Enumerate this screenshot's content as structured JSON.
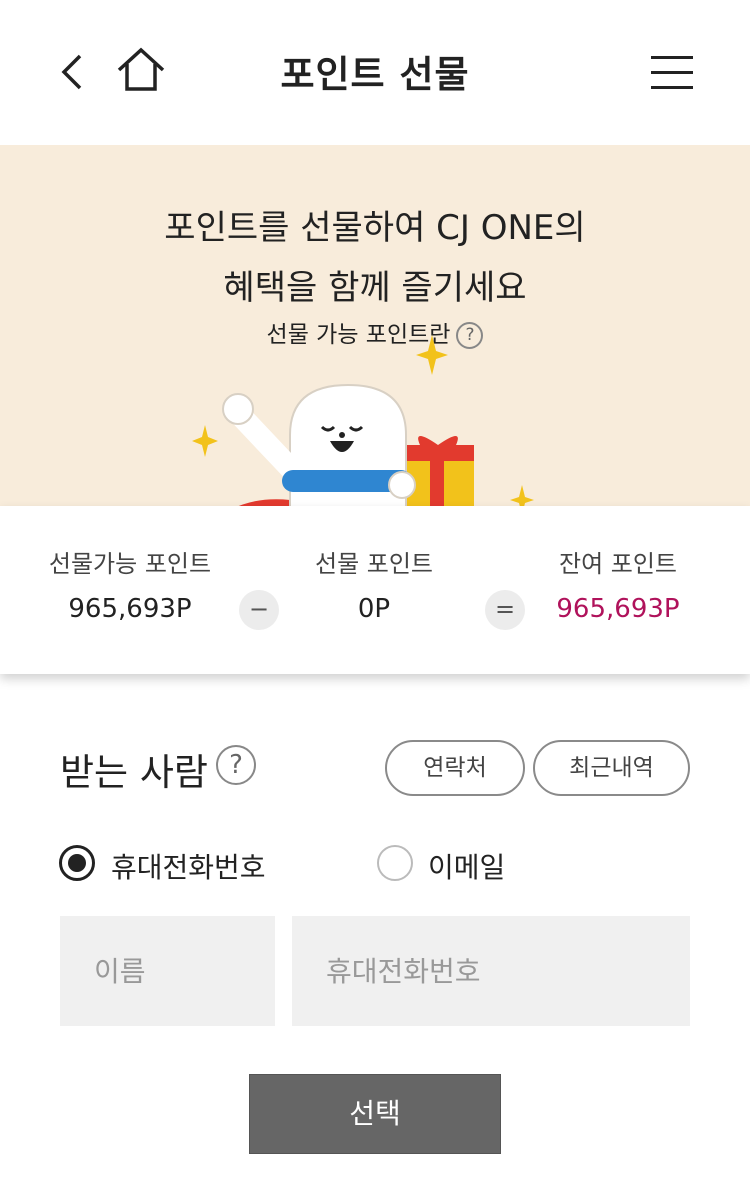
{
  "header": {
    "title": "포인트 선물"
  },
  "banner": {
    "line1": "포인트를 선물하여 CJ ONE의",
    "line2": "혜택을 함께 즐기세요",
    "link_label": "선물 가능 포인트란",
    "help_symbol": "?"
  },
  "summary": {
    "available_label": "선물가능 포인트",
    "available_value": "965,693P",
    "minus_symbol": "−",
    "gift_label": "선물 포인트",
    "gift_value": "0P",
    "equals_symbol": "=",
    "remain_label": "잔여 포인트",
    "remain_value": "965,693P",
    "remain_color": "#b0125b"
  },
  "recipient": {
    "title": "받는 사람",
    "help_symbol": "?",
    "contacts_label": "연락처",
    "recent_label": "최근내역",
    "options": [
      {
        "label": "휴대전화번호",
        "checked": true
      },
      {
        "label": "이메일",
        "checked": false
      }
    ],
    "name_placeholder": "이름",
    "phone_placeholder": "휴대전화번호",
    "select_label": "선택"
  },
  "colors": {
    "banner_bg": "#f8ecdb",
    "accent": "#b0125b",
    "button_bg": "#666666"
  }
}
